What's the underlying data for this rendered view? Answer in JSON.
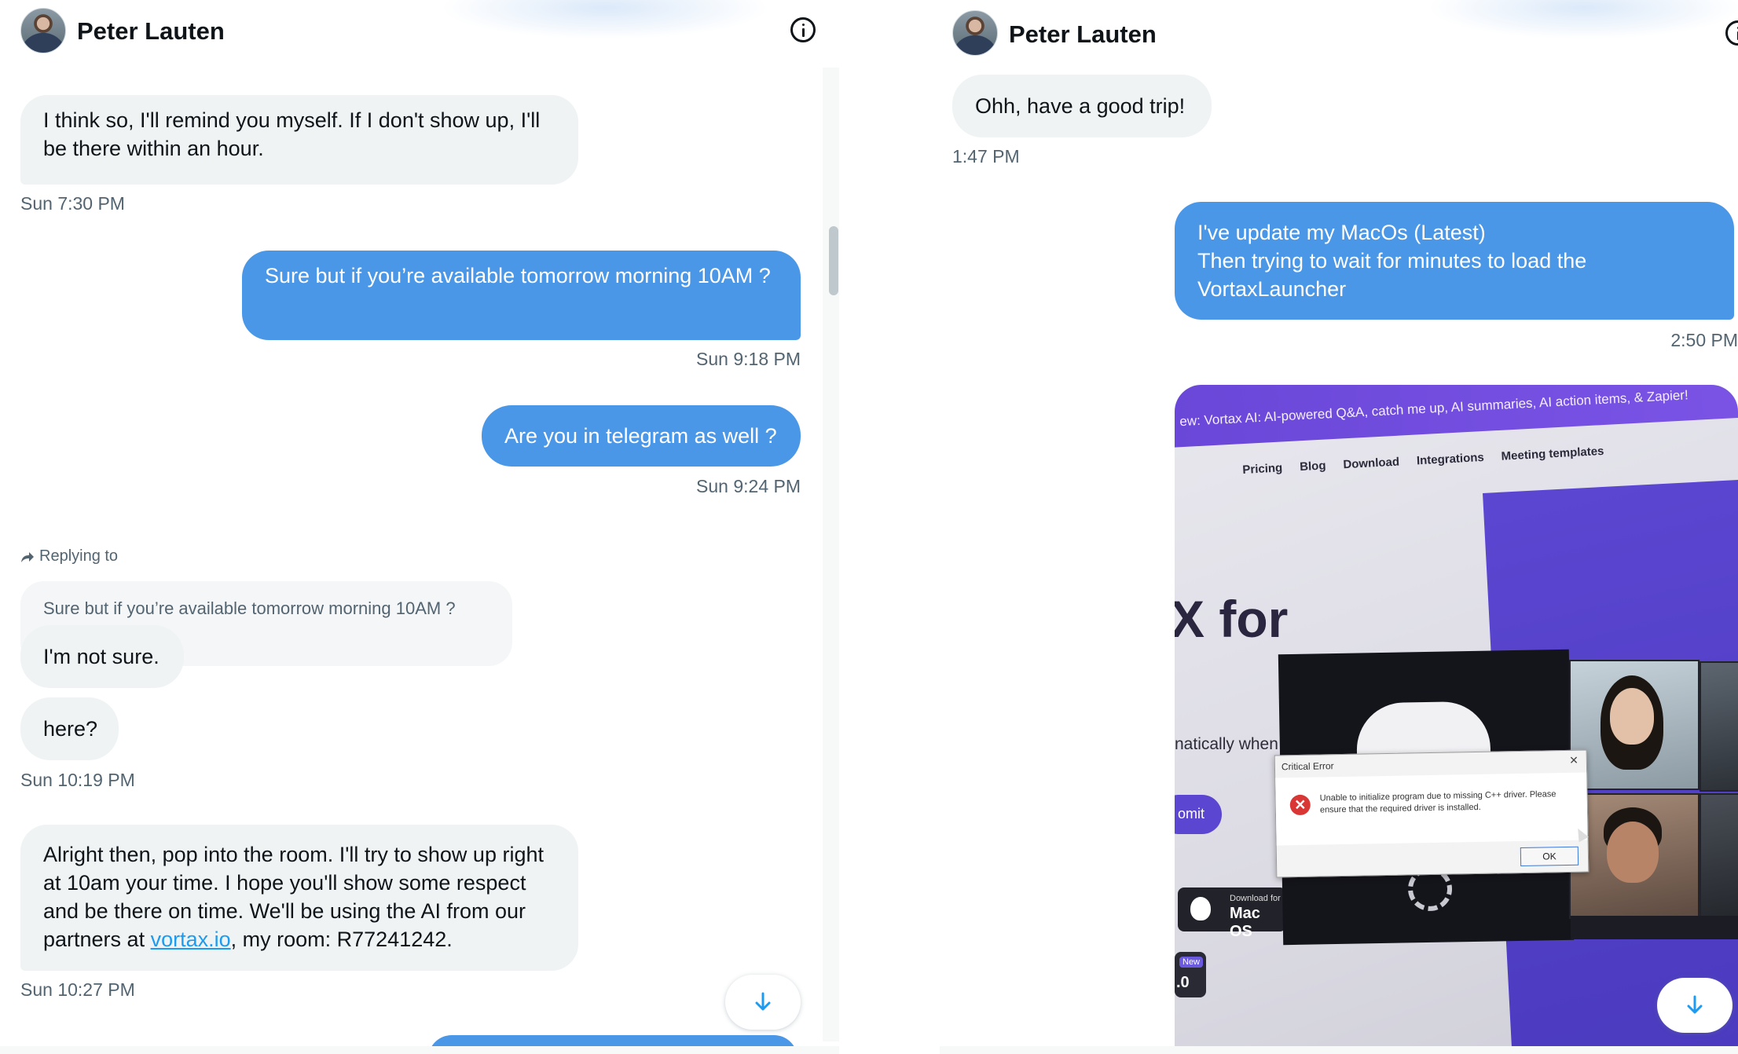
{
  "contact": {
    "name": "Peter Lauten"
  },
  "left": {
    "messages": [
      {
        "dir": "in",
        "text": "I think so, I'll remind you myself. If I don't show up, I'll be there within an hour.",
        "time": "Sun 7:30 PM"
      },
      {
        "dir": "out",
        "text": "Sure but if you’re available tomorrow morning 10AM ?",
        "time": "Sun 9:18 PM"
      },
      {
        "dir": "out",
        "text": "Are you in telegram as well ?",
        "time": "Sun 9:24 PM"
      }
    ],
    "reply": {
      "label": "Replying to",
      "quoted_text": "Sure but if you’re available tomorrow morning 10AM ?",
      "reply_text": "I'm not sure."
    },
    "here_message": {
      "text": "here?",
      "time": "Sun 10:19 PM"
    },
    "last_message": {
      "text_before": "Alright then, pop into the room. I'll try to show up right at 10am your time. I hope you'll show some respect and be there on time. We'll be using the AI from our partners at ",
      "link": "vortax.io",
      "text_after": ", my room: R77241242.",
      "time": "Sun 10:27 PM"
    }
  },
  "right": {
    "messages": [
      {
        "dir": "in",
        "text": "Ohh, have a good trip!",
        "time": "1:47 PM"
      },
      {
        "dir": "out",
        "lines": [
          "I've update my MacOs (Latest)",
          "Then trying to wait for minutes to load the",
          "VortaxLauncher"
        ],
        "time": "2:50 PM"
      }
    ],
    "photo": {
      "banner": "ew: Vortax AI: AI-powered Q&A, catch me up, AI summaries, AI action items, & Zapier!",
      "nav": [
        "Pricing",
        "Blog",
        "Download",
        "Integrations",
        "Meeting templates"
      ],
      "headline": "X for",
      "subtext": "natically when",
      "submit": "omit",
      "download_small": "Download for",
      "download_big": "Mac OS",
      "new_badge": "New",
      "version": ".0",
      "dialog": {
        "title": "Critical Error",
        "message": "Unable to initialize program due to missing C++ driver. Please ensure that the required driver is installed.",
        "ok": "OK",
        "icon": "error-x-icon"
      }
    }
  },
  "colors": {
    "outgoing": "#4a97e8",
    "incoming": "#eff3f4",
    "link": "#1d9bf0",
    "timestamp": "#536471"
  },
  "icons": {
    "info": "info-circle-icon",
    "scroll_down": "arrow-down-icon",
    "reply": "reply-arrow-icon"
  }
}
